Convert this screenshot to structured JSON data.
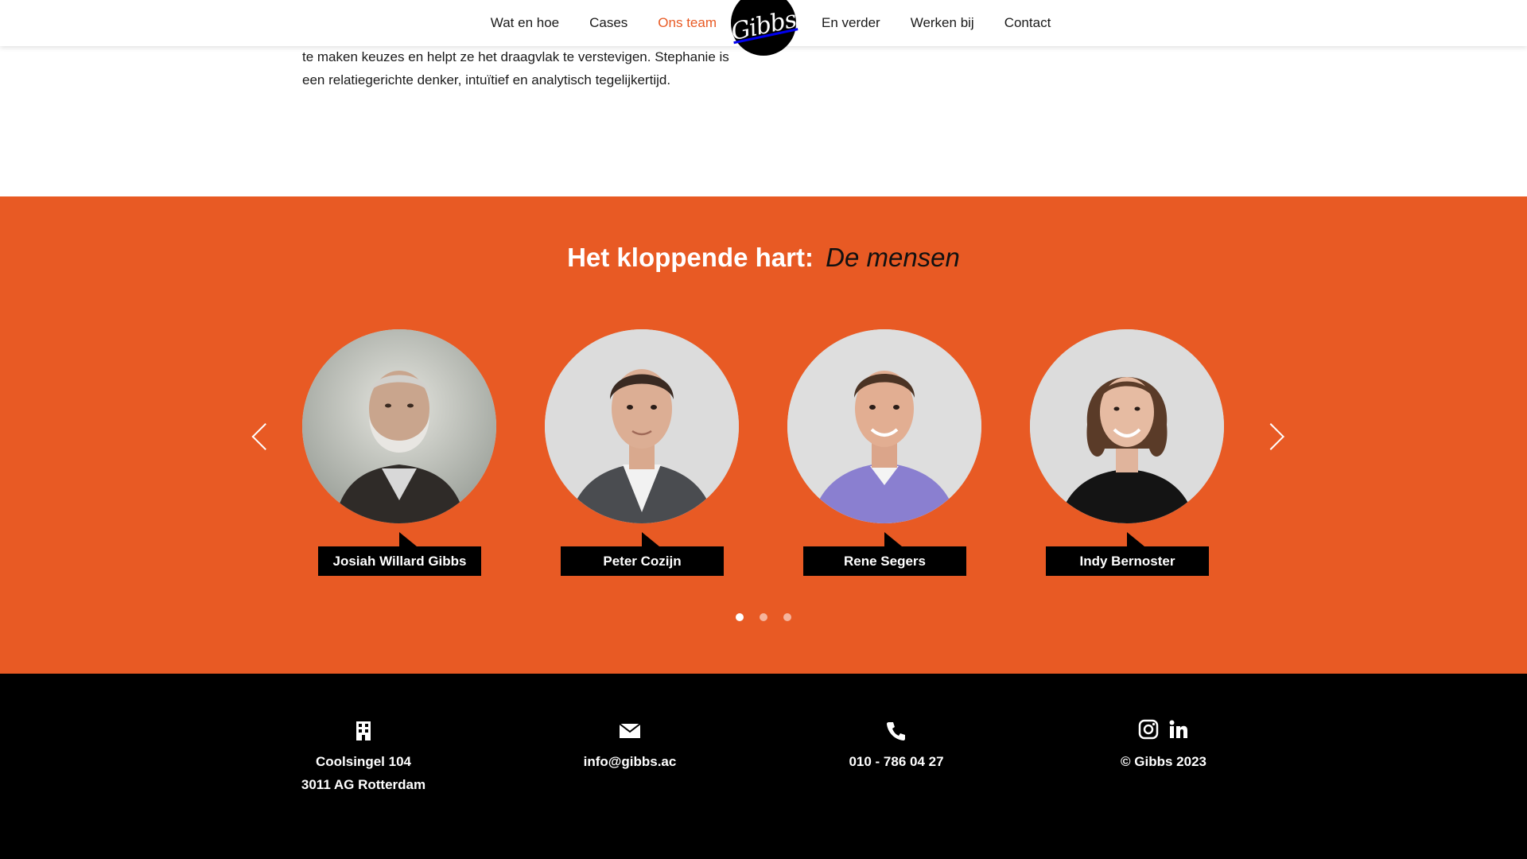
{
  "nav": {
    "left": [
      "Wat en hoe",
      "Cases",
      "Ons team"
    ],
    "right": [
      "En verder",
      "Werken bij",
      "Contact"
    ],
    "active": "Ons team",
    "logo": "Gibbs"
  },
  "intro": {
    "line1": "te maken keuzes en helpt ze het draagvlak te verstevigen. Stephanie is",
    "line2": "een relatiegerichte denker, intuïtief en analytisch tegelijkertijd."
  },
  "team": {
    "title_bold": "Het kloppende hart:",
    "title_italic": "De mensen",
    "members": [
      {
        "name": "Josiah Willard Gibbs"
      },
      {
        "name": "Peter Cozijn"
      },
      {
        "name": "Rene Segers"
      },
      {
        "name": "Indy Bernoster"
      }
    ],
    "dots": 3,
    "active_dot": 1
  },
  "footer": {
    "address_line1": "Coolsingel 104",
    "address_line2": "3011 AG Rotterdam",
    "email": "info@gibbs.ac",
    "phone": "010 - 786 04 27",
    "copyright": "© Gibbs 2023"
  },
  "colors": {
    "accent": "#e85a24",
    "footer_bg": "#000000",
    "tag_bg": "#000000"
  },
  "icons": {
    "address": "building-icon",
    "email": "envelope-icon",
    "phone": "phone-icon",
    "social": [
      "instagram-icon",
      "linkedin-icon"
    ]
  }
}
